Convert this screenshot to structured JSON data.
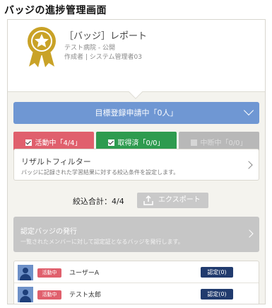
{
  "page": {
    "title": "バッジの進捗管理画面"
  },
  "header": {
    "badge_title": "［バッジ］レポート",
    "organization": "テスト病院 - 公開",
    "author": "作成者 | システム管理者03"
  },
  "target_bar": {
    "label": "目標登録申請中「0人」"
  },
  "status_buttons": [
    {
      "label": "活動中「4/4」",
      "checked": true
    },
    {
      "label": "取得済「0/0」",
      "checked": true
    },
    {
      "label": "中断中「0/0」",
      "checked": false
    }
  ],
  "filter": {
    "title": "リザルトフィルター",
    "description": "バッジに記録された学習結果に対する絞込条件を設定します。"
  },
  "summary": {
    "total_label": "絞込合計：4/4",
    "export_label": "エクスポート"
  },
  "certification": {
    "title": "認定バッジの発行",
    "description": "一覧されたメンバーに対して認定証となるバッジを発行します。"
  },
  "members": [
    {
      "status": "活動中",
      "name": "ユーザーA",
      "action": "認定(0)"
    },
    {
      "status": "活動中",
      "name": "テスト太郎",
      "action": "認定(0)"
    }
  ],
  "colors": {
    "accent_blue": "#6f97d3",
    "active_red": "#e0606d",
    "acquired_green": "#2e9b4f",
    "disabled_gray": "#b8b8b8",
    "navy_button": "#213b6e",
    "badge_gold": "#c9a227"
  }
}
